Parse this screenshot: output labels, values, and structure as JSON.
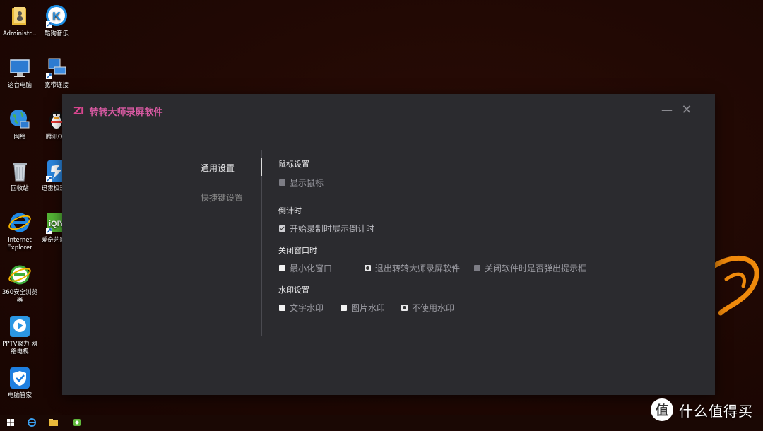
{
  "desktop": {
    "icons": [
      {
        "label": "Administr...",
        "icon": "folder-icon"
      },
      {
        "label": "酷狗音乐",
        "icon": "kugou-music-icon"
      },
      {
        "label": "这台电脑",
        "icon": "computer-icon"
      },
      {
        "label": "宽带连接",
        "icon": "broadband-icon"
      },
      {
        "label": "网络",
        "icon": "network-globe-icon"
      },
      {
        "label": "腾讯QQ",
        "icon": "qq-penguin-icon"
      },
      {
        "label": "回收站",
        "icon": "recycle-bin-icon"
      },
      {
        "label": "迅雷极速版",
        "icon": "thunder-icon"
      },
      {
        "label": "Internet Explorer",
        "icon": "ie-icon"
      },
      {
        "label": "爱奇艺影音",
        "icon": "iqiyi-icon"
      },
      {
        "label": "360安全浏览器",
        "icon": "360-browser-icon"
      },
      {
        "label": "PPTV聚力 网络电视",
        "icon": "pptv-icon"
      },
      {
        "label": "电脑管家",
        "icon": "shield-icon"
      }
    ]
  },
  "watermark": {
    "text": "什么值得买",
    "logo": "值"
  },
  "app": {
    "logo_mark": "ZI",
    "title": "转转大师录屏软件",
    "controls": {
      "minimize": "—",
      "close": "✕"
    },
    "nav": [
      {
        "label": "通用设置",
        "active": true
      },
      {
        "label": "快捷键设置",
        "active": false
      }
    ],
    "sections": {
      "mouse": {
        "title": "鼠标设置",
        "options": [
          {
            "label": "显示鼠标",
            "state": "unchecked-grey"
          }
        ]
      },
      "countdown": {
        "title": "倒计时",
        "options": [
          {
            "label": "开始录制时展示倒计时",
            "state": "checked"
          }
        ]
      },
      "close_window": {
        "title": "关闭窗口时",
        "options": [
          {
            "label": "最小化窗口",
            "state": "unchecked"
          },
          {
            "label": "退出转转大师录屏软件",
            "state": "radio-selected"
          },
          {
            "label": "关闭软件时是否弹出提示框",
            "state": "unchecked-grey"
          }
        ]
      },
      "watermark": {
        "title": "水印设置",
        "options": [
          {
            "label": "文字水印",
            "state": "unchecked"
          },
          {
            "label": "图片水印",
            "state": "unchecked"
          },
          {
            "label": "不使用水印",
            "state": "radio-selected"
          }
        ]
      }
    }
  },
  "colors": {
    "window_bg": "#2b2b2f",
    "brand_pink": "#d85aa2",
    "desktop_bg": "#1f0804",
    "swirl_orange": "#f08a0c"
  }
}
